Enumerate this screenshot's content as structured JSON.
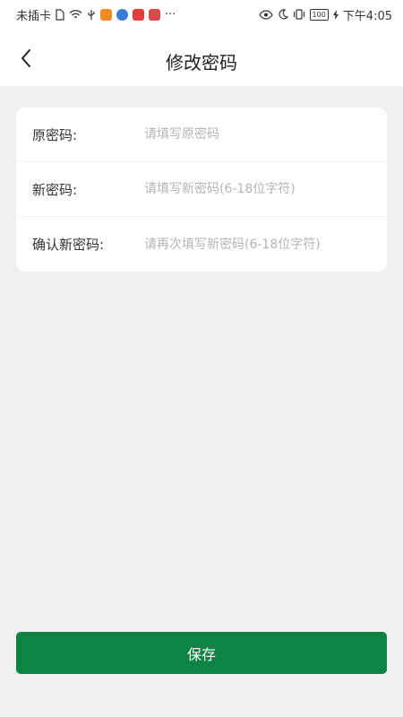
{
  "status_bar": {
    "carrier": "未插卡",
    "time": "下午4:05",
    "battery": "100",
    "more": "···",
    "icons": [
      "sim-icon",
      "wifi-icon",
      "usb-icon",
      "app-video-icon",
      "app-music-icon",
      "app-red-icon",
      "app-calendar-icon",
      "eye-icon",
      "moon-icon",
      "vibrate-icon",
      "battery-icon",
      "charging-icon"
    ],
    "colors": {
      "app_video": "#f08a24",
      "app_music": "#3a7bd5",
      "app_red": "#e23c3c",
      "app_calendar": "#d94a4a"
    }
  },
  "header": {
    "title": "修改密码",
    "back_icon": "chevron-left-icon"
  },
  "form": {
    "fields": [
      {
        "label": "原密码:",
        "placeholder": "请填写原密码",
        "value": ""
      },
      {
        "label": "新密码:",
        "placeholder": "请填写新密码(6-18位字符)",
        "value": ""
      },
      {
        "label": "确认新密码:",
        "placeholder": "请再次填写新密码(6-18位字符)",
        "value": ""
      }
    ]
  },
  "actions": {
    "save_label": "保存",
    "save_color": "#0e8444"
  }
}
